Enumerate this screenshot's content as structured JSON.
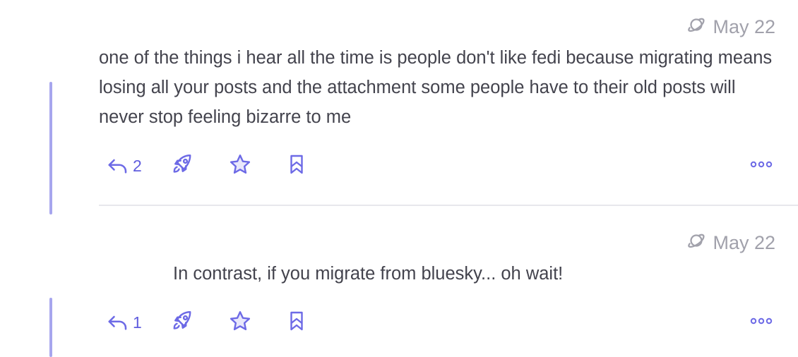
{
  "posts": [
    {
      "timestamp": "May 22",
      "text": "one of the things i hear all the time is people don't like fedi because migrating means losing all your posts and the attachment some people have to their old posts will never stop feeling bizarre to me",
      "reply_count": "2"
    },
    {
      "timestamp": "May 22",
      "text": "In contrast, if you migrate from bluesky... oh wait!",
      "reply_count": "1"
    }
  ],
  "colors": {
    "accent": "#6d6ae6",
    "thread_line": "#a7a6ee",
    "timestamp": "#a1a1ab",
    "text": "#43434d"
  },
  "icons": [
    "planet-icon",
    "reply-icon",
    "rocket-icon",
    "star-icon",
    "bookmark-icon",
    "more-icon"
  ]
}
